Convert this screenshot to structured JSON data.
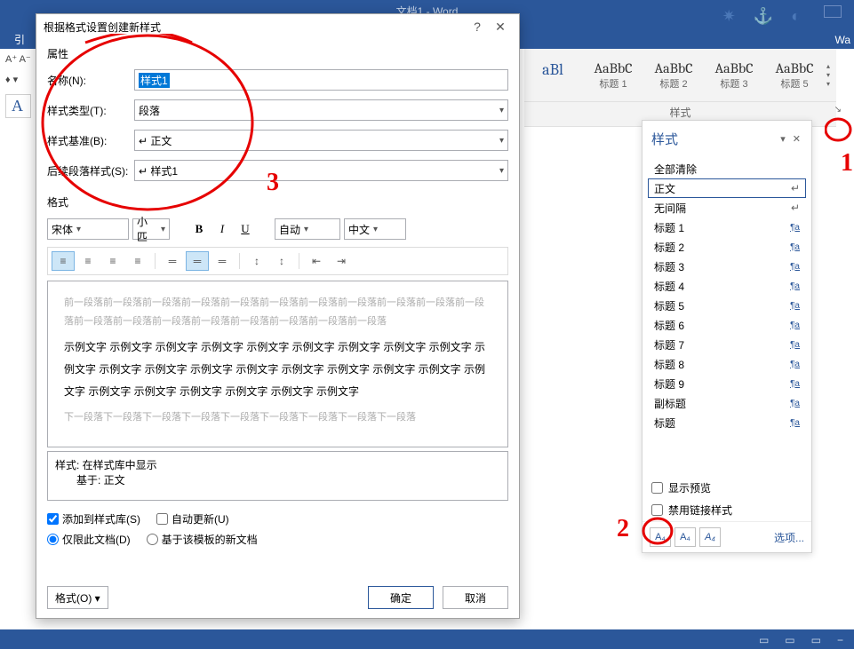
{
  "app": {
    "title": "文档1 - Word",
    "ribbon_tab": "引",
    "right_text": "Wa"
  },
  "gallery": {
    "items": [
      {
        "preview": "aBl",
        "label": ""
      },
      {
        "preview": "AaBbC",
        "label": "标题 1"
      },
      {
        "preview": "AaBbC",
        "label": "标题 2"
      },
      {
        "preview": "AaBbC",
        "label": "标题 3"
      },
      {
        "preview": "AaBbC",
        "label": "标题 5"
      }
    ],
    "group_label": "样式"
  },
  "dialog": {
    "title": "根据格式设置创建新样式",
    "section_props": "属性",
    "name_label": "名称(N):",
    "name_value": "样式1",
    "type_label": "样式类型(T):",
    "type_value": "段落",
    "base_label": "样式基准(B):",
    "base_value": "↵ 正文",
    "follow_label": "后续段落样式(S):",
    "follow_value": "↵ 样式1",
    "section_format": "格式",
    "font_name": "宋体",
    "font_size": "小匹",
    "color_auto": "自动",
    "lang": "中文",
    "preview_prev": "前一段落前一段落前一段落前一段落前一段落前一段落前一段落前一段落前一段落前一段落前一段落前一段落前一段落前一段落前一段落前一段落前一段落前一段落前一段落",
    "preview_sample": "示例文字 示例文字 示例文字 示例文字 示例文字 示例文字 示例文字 示例文字 示例文字 示例文字 示例文字 示例文字 示例文字 示例文字 示例文字 示例文字 示例文字 示例文字 示例文字 示例文字 示例文字 示例文字 示例文字 示例文字 示例文字",
    "preview_next": "下一段落下一段落下一段落下一段落下一段落下一段落下一段落下一段落下一段落",
    "desc_line1": "样式: 在样式库中显示",
    "desc_line2": "基于: 正文",
    "chk_add": "添加到样式库(S)",
    "chk_auto": "自动更新(U)",
    "rad_doc": "仅限此文档(D)",
    "rad_tpl": "基于该模板的新文档",
    "btn_format": "格式(O) ▾",
    "btn_ok": "确定",
    "btn_cancel": "取消"
  },
  "pane": {
    "title": "样式",
    "clear": "全部清除",
    "items": [
      {
        "name": "正文",
        "ind": "↵",
        "sel": true
      },
      {
        "name": "无间隔",
        "ind": "↵"
      },
      {
        "name": "标题 1",
        "ind": "¶a"
      },
      {
        "name": "标题 2",
        "ind": "¶a"
      },
      {
        "name": "标题 3",
        "ind": "¶a"
      },
      {
        "name": "标题 4",
        "ind": "¶a"
      },
      {
        "name": "标题 5",
        "ind": "¶a"
      },
      {
        "name": "标题 6",
        "ind": "¶a"
      },
      {
        "name": "标题 7",
        "ind": "¶a"
      },
      {
        "name": "标题 8",
        "ind": "¶a"
      },
      {
        "name": "标题 9",
        "ind": "¶a"
      },
      {
        "name": "副标题",
        "ind": "¶a"
      },
      {
        "name": "标题",
        "ind": "¶a"
      }
    ],
    "chk_preview": "显示预览",
    "chk_disable": "禁用链接样式",
    "options": "选项..."
  },
  "annotations": {
    "n1": "1",
    "n2": "2",
    "n3": "3"
  }
}
